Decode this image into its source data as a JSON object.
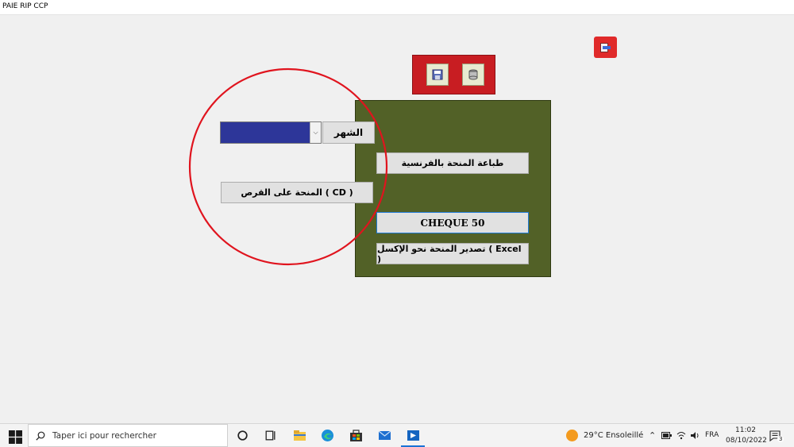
{
  "window": {
    "title": "PAIE RIP CCP"
  },
  "form": {
    "month_label": "الشهر",
    "month_value": "",
    "cd_button": "المنحة على القرص ( CD )",
    "print_french_button": "طباعة المنحة بالفرنسية",
    "cheque_button": "CHEQUE 50",
    "export_excel_button": "تصدير المنحة  نحو  الإكسل ( Excel )"
  },
  "colors": {
    "green_panel": "#526127",
    "red_panel": "#c81d22",
    "combo_fill": "#2d3699",
    "annotation_circle": "#e0141e"
  },
  "icons": {
    "save": "floppy-save-icon",
    "db": "database-icon",
    "close": "exit-icon"
  },
  "taskbar": {
    "search_placeholder": "Taper ici pour rechercher",
    "weather": "29°C  Ensoleillé",
    "language": "FRA",
    "time": "11:02",
    "date": "08/10/2022",
    "notification_count": "3"
  }
}
